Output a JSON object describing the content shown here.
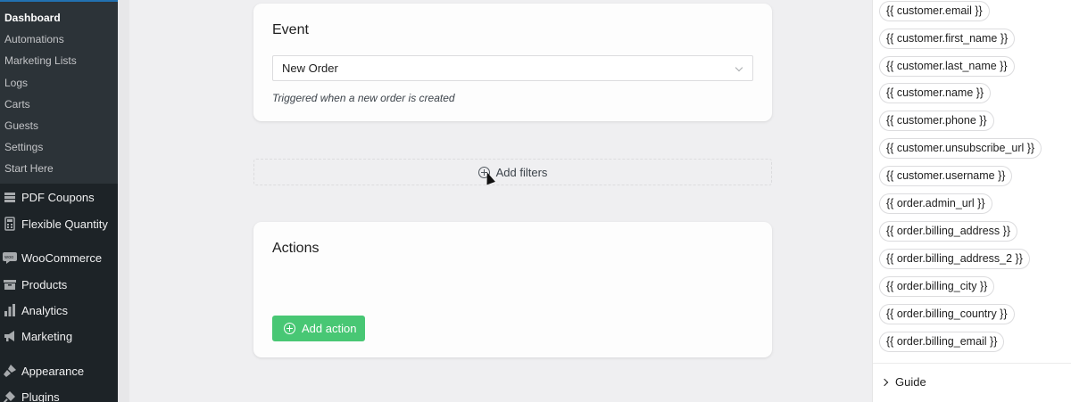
{
  "sidebar": {
    "submenu": [
      {
        "label": "Dashboard",
        "current": true
      },
      {
        "label": "Automations"
      },
      {
        "label": "Marketing Lists"
      },
      {
        "label": "Logs"
      },
      {
        "label": "Carts"
      },
      {
        "label": "Guests"
      },
      {
        "label": "Settings"
      },
      {
        "label": "Start Here"
      }
    ],
    "menu": [
      {
        "label": "PDF Coupons",
        "icon": "coupon-icon"
      },
      {
        "label": "Flexible Quantity",
        "icon": "calculator-icon"
      },
      {
        "label": "WooCommerce",
        "icon": "woocommerce-icon"
      },
      {
        "label": "Products",
        "icon": "box-icon"
      },
      {
        "label": "Analytics",
        "icon": "bar-chart-icon"
      },
      {
        "label": "Marketing",
        "icon": "megaphone-icon"
      },
      {
        "label": "Appearance",
        "icon": "paintbrush-icon"
      },
      {
        "label": "Plugins",
        "icon": "plugin-icon"
      }
    ]
  },
  "event": {
    "title": "Event",
    "selected": "New Order",
    "description": "Triggered when a new order is created"
  },
  "filters": {
    "label": "Add filters"
  },
  "actions": {
    "title": "Actions",
    "button_label": "Add action"
  },
  "variables": [
    "{{ customer.email }}",
    "{{ customer.first_name }}",
    "{{ customer.last_name }}",
    "{{ customer.name }}",
    "{{ customer.phone }}",
    "{{ customer.unsubscribe_url }}",
    "{{ customer.username }}",
    "{{ order.admin_url }}",
    "{{ order.billing_address }}",
    "{{ order.billing_address_2 }}",
    "{{ order.billing_city }}",
    "{{ order.billing_country }}",
    "{{ order.billing_email }}"
  ],
  "guide": {
    "label": "Guide"
  },
  "colors": {
    "sidebar_bg": "#1d2327",
    "submenu_bg": "#2c3338",
    "accent_green": "#48c774"
  }
}
